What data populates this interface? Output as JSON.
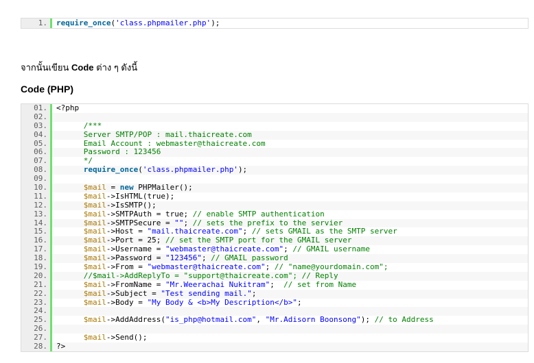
{
  "snippet1": {
    "lines": [
      {
        "num": "1.",
        "parts": [
          {
            "t": "require_once",
            "c": "kw"
          },
          {
            "t": "(",
            "c": ""
          },
          {
            "t": "'class.phpmailer.php'",
            "c": "str"
          },
          {
            "t": ");",
            "c": ""
          }
        ]
      }
    ]
  },
  "intro": {
    "prefix": "จากนั้นเขียน ",
    "bold": "Code",
    "suffix": " ต่าง ๆ ดังนี้"
  },
  "heading": "Code (PHP)",
  "snippet2": {
    "lines": [
      {
        "num": "01.",
        "parts": [
          {
            "t": "<?php",
            "c": ""
          }
        ]
      },
      {
        "num": "02.",
        "parts": []
      },
      {
        "num": "03.",
        "parts": [
          {
            "t": "      /***",
            "c": "cmt"
          }
        ]
      },
      {
        "num": "04.",
        "parts": [
          {
            "t": "      Server SMTP/POP : mail.thaicreate.com",
            "c": "cmt"
          }
        ]
      },
      {
        "num": "05.",
        "parts": [
          {
            "t": "      Email Account : webmaster@thaicreate.com",
            "c": "cmt"
          }
        ]
      },
      {
        "num": "06.",
        "parts": [
          {
            "t": "      Password : 123456",
            "c": "cmt"
          }
        ]
      },
      {
        "num": "07.",
        "parts": [
          {
            "t": "      */",
            "c": "cmt"
          }
        ]
      },
      {
        "num": "08.",
        "parts": [
          {
            "t": "      ",
            "c": ""
          },
          {
            "t": "require_once",
            "c": "kw"
          },
          {
            "t": "(",
            "c": ""
          },
          {
            "t": "'class.phpmailer.php'",
            "c": "str"
          },
          {
            "t": ");",
            "c": ""
          }
        ]
      },
      {
        "num": "09.",
        "parts": []
      },
      {
        "num": "10.",
        "parts": [
          {
            "t": "      ",
            "c": ""
          },
          {
            "t": "$mail",
            "c": "var"
          },
          {
            "t": " = ",
            "c": ""
          },
          {
            "t": "new",
            "c": "kw"
          },
          {
            "t": " PHPMailer();",
            "c": ""
          }
        ]
      },
      {
        "num": "11.",
        "parts": [
          {
            "t": "      ",
            "c": ""
          },
          {
            "t": "$mail",
            "c": "var"
          },
          {
            "t": "->IsHTML(true);",
            "c": ""
          }
        ]
      },
      {
        "num": "12.",
        "parts": [
          {
            "t": "      ",
            "c": ""
          },
          {
            "t": "$mail",
            "c": "var"
          },
          {
            "t": "->IsSMTP();",
            "c": ""
          }
        ]
      },
      {
        "num": "13.",
        "parts": [
          {
            "t": "      ",
            "c": ""
          },
          {
            "t": "$mail",
            "c": "var"
          },
          {
            "t": "->SMTPAuth = true; ",
            "c": ""
          },
          {
            "t": "// enable SMTP authentication",
            "c": "cmt"
          }
        ]
      },
      {
        "num": "14.",
        "parts": [
          {
            "t": "      ",
            "c": ""
          },
          {
            "t": "$mail",
            "c": "var"
          },
          {
            "t": "->SMTPSecure = ",
            "c": ""
          },
          {
            "t": "\"\"",
            "c": "str"
          },
          {
            "t": "; ",
            "c": ""
          },
          {
            "t": "// sets the prefix to the servier",
            "c": "cmt"
          }
        ]
      },
      {
        "num": "15.",
        "parts": [
          {
            "t": "      ",
            "c": ""
          },
          {
            "t": "$mail",
            "c": "var"
          },
          {
            "t": "->Host = ",
            "c": ""
          },
          {
            "t": "\"mail.thaicreate.com\"",
            "c": "str"
          },
          {
            "t": "; ",
            "c": ""
          },
          {
            "t": "// sets GMAIL as the SMTP server",
            "c": "cmt"
          }
        ]
      },
      {
        "num": "16.",
        "parts": [
          {
            "t": "      ",
            "c": ""
          },
          {
            "t": "$mail",
            "c": "var"
          },
          {
            "t": "->Port = 25; ",
            "c": ""
          },
          {
            "t": "// set the SMTP port for the GMAIL server",
            "c": "cmt"
          }
        ]
      },
      {
        "num": "17.",
        "parts": [
          {
            "t": "      ",
            "c": ""
          },
          {
            "t": "$mail",
            "c": "var"
          },
          {
            "t": "->Username = ",
            "c": ""
          },
          {
            "t": "\"webmaster@thaicreate.com\"",
            "c": "str"
          },
          {
            "t": "; ",
            "c": ""
          },
          {
            "t": "// GMAIL username",
            "c": "cmt"
          }
        ]
      },
      {
        "num": "18.",
        "parts": [
          {
            "t": "      ",
            "c": ""
          },
          {
            "t": "$mail",
            "c": "var"
          },
          {
            "t": "->Password = ",
            "c": ""
          },
          {
            "t": "\"123456\"",
            "c": "str"
          },
          {
            "t": "; ",
            "c": ""
          },
          {
            "t": "// GMAIL password",
            "c": "cmt"
          }
        ]
      },
      {
        "num": "19.",
        "parts": [
          {
            "t": "      ",
            "c": ""
          },
          {
            "t": "$mail",
            "c": "var"
          },
          {
            "t": "->From = ",
            "c": ""
          },
          {
            "t": "\"webmaster@thaicreate.com\"",
            "c": "str"
          },
          {
            "t": "; ",
            "c": ""
          },
          {
            "t": "// \"name@yourdomain.com\";",
            "c": "cmt"
          }
        ]
      },
      {
        "num": "20.",
        "parts": [
          {
            "t": "      ",
            "c": ""
          },
          {
            "t": "//$mail->AddReplyTo = \"support@thaicreate.com\"; // Reply",
            "c": "cmt"
          }
        ]
      },
      {
        "num": "21.",
        "parts": [
          {
            "t": "      ",
            "c": ""
          },
          {
            "t": "$mail",
            "c": "var"
          },
          {
            "t": "->FromName = ",
            "c": ""
          },
          {
            "t": "\"Mr.Weerachai Nukitram\"",
            "c": "str"
          },
          {
            "t": ";  ",
            "c": ""
          },
          {
            "t": "// set from Name",
            "c": "cmt"
          }
        ]
      },
      {
        "num": "22.",
        "parts": [
          {
            "t": "      ",
            "c": ""
          },
          {
            "t": "$mail",
            "c": "var"
          },
          {
            "t": "->Subject = ",
            "c": ""
          },
          {
            "t": "\"Test sending mail.\"",
            "c": "str"
          },
          {
            "t": ";",
            "c": ""
          }
        ]
      },
      {
        "num": "23.",
        "parts": [
          {
            "t": "      ",
            "c": ""
          },
          {
            "t": "$mail",
            "c": "var"
          },
          {
            "t": "->Body = ",
            "c": ""
          },
          {
            "t": "\"My Body & <b>My Description</b>\"",
            "c": "str"
          },
          {
            "t": ";",
            "c": ""
          }
        ]
      },
      {
        "num": "24.",
        "parts": []
      },
      {
        "num": "25.",
        "parts": [
          {
            "t": "      ",
            "c": ""
          },
          {
            "t": "$mail",
            "c": "var"
          },
          {
            "t": "->AddAddress(",
            "c": ""
          },
          {
            "t": "\"is_php@hotmail.com\"",
            "c": "str"
          },
          {
            "t": ", ",
            "c": ""
          },
          {
            "t": "\"Mr.Adisorn Boonsong\"",
            "c": "str"
          },
          {
            "t": "); ",
            "c": ""
          },
          {
            "t": "// to Address",
            "c": "cmt"
          }
        ]
      },
      {
        "num": "26.",
        "parts": []
      },
      {
        "num": "27.",
        "parts": [
          {
            "t": "      ",
            "c": ""
          },
          {
            "t": "$mail",
            "c": "var"
          },
          {
            "t": "->Send();",
            "c": ""
          }
        ]
      },
      {
        "num": "28.",
        "parts": [
          {
            "t": "?>",
            "c": ""
          }
        ]
      }
    ]
  }
}
